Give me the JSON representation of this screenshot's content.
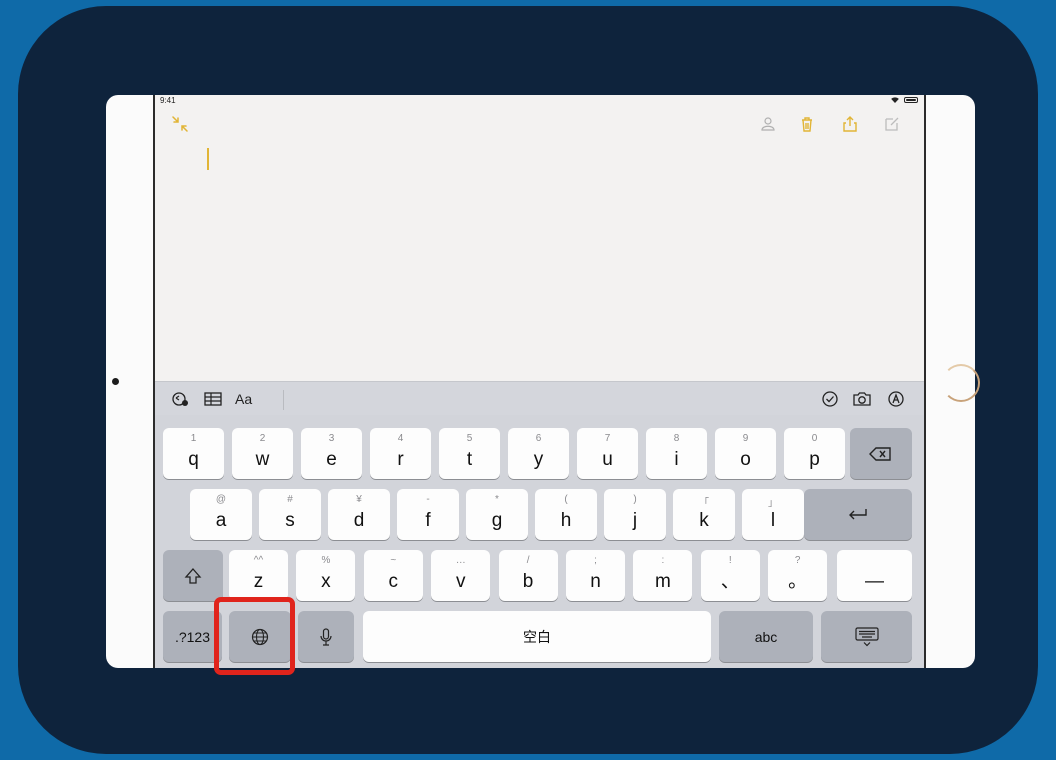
{
  "status_bar": {
    "time": "9:41"
  },
  "format_bar": {
    "text_style_label": "Aa"
  },
  "keyboard": {
    "row1": [
      {
        "alt": "1",
        "label": "q"
      },
      {
        "alt": "2",
        "label": "w"
      },
      {
        "alt": "3",
        "label": "e"
      },
      {
        "alt": "4",
        "label": "r"
      },
      {
        "alt": "5",
        "label": "t"
      },
      {
        "alt": "6",
        "label": "y"
      },
      {
        "alt": "7",
        "label": "u"
      },
      {
        "alt": "8",
        "label": "i"
      },
      {
        "alt": "9",
        "label": "o"
      },
      {
        "alt": "0",
        "label": "p"
      }
    ],
    "row2": [
      {
        "alt": "@",
        "label": "a"
      },
      {
        "alt": "#",
        "label": "s"
      },
      {
        "alt": "¥",
        "label": "d"
      },
      {
        "alt": "-",
        "label": "f"
      },
      {
        "alt": "*",
        "label": "g"
      },
      {
        "alt": "(",
        "label": "h"
      },
      {
        "alt": ")",
        "label": "j"
      },
      {
        "alt": "「",
        "label": "k"
      },
      {
        "alt": "」",
        "label": "l"
      }
    ],
    "row3": [
      {
        "alt": "^^",
        "label": "z"
      },
      {
        "alt": "%",
        "label": "x"
      },
      {
        "alt": "~",
        "label": "c"
      },
      {
        "alt": "…",
        "label": "v"
      },
      {
        "alt": "/",
        "label": "b"
      },
      {
        "alt": ";",
        "label": "n"
      },
      {
        "alt": ":",
        "label": "m"
      },
      {
        "alt": "!",
        "label": "、"
      },
      {
        "alt": "?",
        "label": "。"
      }
    ],
    "dash_key": "—",
    "numbers_key": ".?123",
    "space_key": "空白",
    "abc_key": "abc"
  },
  "colors": {
    "accent": "#e1b536",
    "highlight": "#e0241c",
    "background": "#0f6aa8",
    "frame": "#0e233c"
  }
}
